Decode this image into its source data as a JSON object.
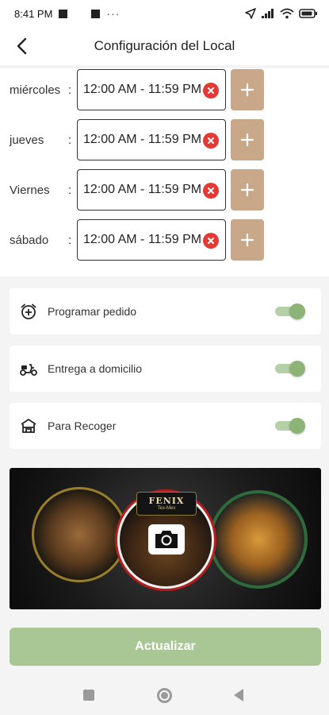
{
  "status_bar": {
    "time": "8:41 PM",
    "overflow": "···",
    "icons": [
      "notification-square-icon",
      "notification-square-icon",
      "location-arrow-icon",
      "signal-icon",
      "wifi-icon",
      "battery-icon"
    ]
  },
  "header": {
    "title": "Configuración del Local",
    "back_icon": "chevron-left-icon"
  },
  "schedule": {
    "separator": ":",
    "days": [
      {
        "day": "miércoles",
        "hours": "12:00 AM - 11:59 PM"
      },
      {
        "day": "jueves",
        "hours": "12:00 AM - 11:59 PM"
      },
      {
        "day": "Viernes",
        "hours": "12:00 AM - 11:59 PM"
      },
      {
        "day": "sábado",
        "hours": "12:00 AM - 11:59 PM"
      }
    ],
    "clear_icon": "clear-x-icon",
    "add_icon": "plus-icon"
  },
  "options": [
    {
      "label": "Programar pedido",
      "icon": "alarm-add-icon",
      "enabled": true
    },
    {
      "label": "Entrega a domicilio",
      "icon": "scooter-icon",
      "enabled": true
    },
    {
      "label": "Para Recoger",
      "icon": "store-icon",
      "enabled": true
    }
  ],
  "banner": {
    "logo_title": "FENIX",
    "logo_subtitle": "Tex-Mex",
    "camera_icon": "camera-icon"
  },
  "actions": {
    "update_label": "Actualizar"
  },
  "colors": {
    "accent_green": "#a9c794",
    "toggle_green": "#8bb476",
    "add_button_tan": "#c8a888",
    "clear_red": "#e53935"
  }
}
